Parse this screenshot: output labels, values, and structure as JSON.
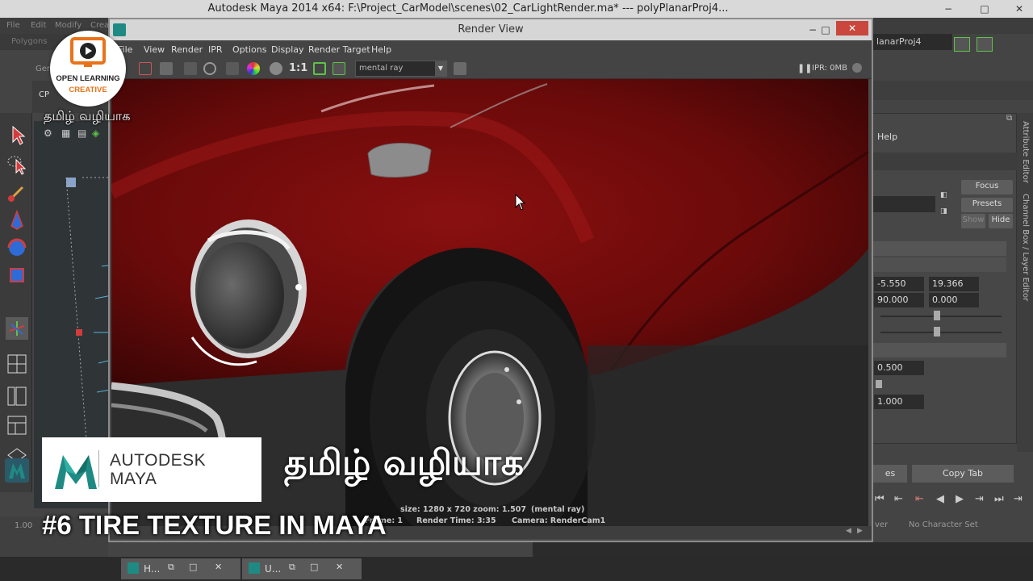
{
  "maya": {
    "title": "Autodesk Maya 2014 x64: F:\\Project_CarModel\\scenes\\02_CarLightRender.ma*   ---   polyPlanarProj4...",
    "menu": [
      "File",
      "Edit",
      "Modify",
      "Crea"
    ],
    "menuset": "Polygons",
    "shelf_cp": "CP",
    "shelf_gen": "Gen",
    "right_field": "lanarProj4",
    "win_min": "−",
    "win_max": "□",
    "win_close": "✕"
  },
  "render_view": {
    "title": "Render View",
    "menu": [
      "File",
      "View",
      "Render",
      "IPR",
      "Options",
      "Display",
      "Render Target",
      "Help"
    ],
    "ratio_label": "1:1",
    "renderer": "mental ray",
    "ipr_memory": "IPR: 0MB",
    "info": {
      "size": "size: 1280 x 720 zoom: 1.507",
      "renderer": "(mental ray)",
      "frame": "Frame: 1",
      "render_time": "Render Time:  3:35",
      "camera": "Camera: RenderCam1"
    }
  },
  "attribute_editor": {
    "help": "Help",
    "focus": "Focus",
    "presets": "Presets",
    "show": "Show",
    "hide": "Hide",
    "fields": [
      "-5.550",
      "19.366",
      "90.000",
      "0.000",
      "0.500",
      "1.000"
    ],
    "copy_tab": "Copy Tab",
    "left_tab_partial": "es",
    "side_tabs": [
      "Attribute Editor",
      "Channel Box / Layer Editor"
    ]
  },
  "timeline": {
    "start": "1.00",
    "char_set": "No Character Set",
    "layer_partial": "ver"
  },
  "taskbar": {
    "items": [
      "H...",
      "U..."
    ]
  },
  "overlay": {
    "logo_line1": "OPEN LEARNING",
    "logo_line2": "CREATIVE",
    "tamil_small": "தமிழ் வழியாக",
    "brand_line1": "AUTODESK",
    "brand_line2": "MAYA",
    "tamil_big": "தமிழ் வழியாக",
    "episode_title": "#6 TIRE TEXTURE IN MAYA"
  },
  "colors": {
    "car_paint": "#7a0c0c",
    "maya_teal": "#1f8a83",
    "logo_orange": "#e8731a"
  }
}
